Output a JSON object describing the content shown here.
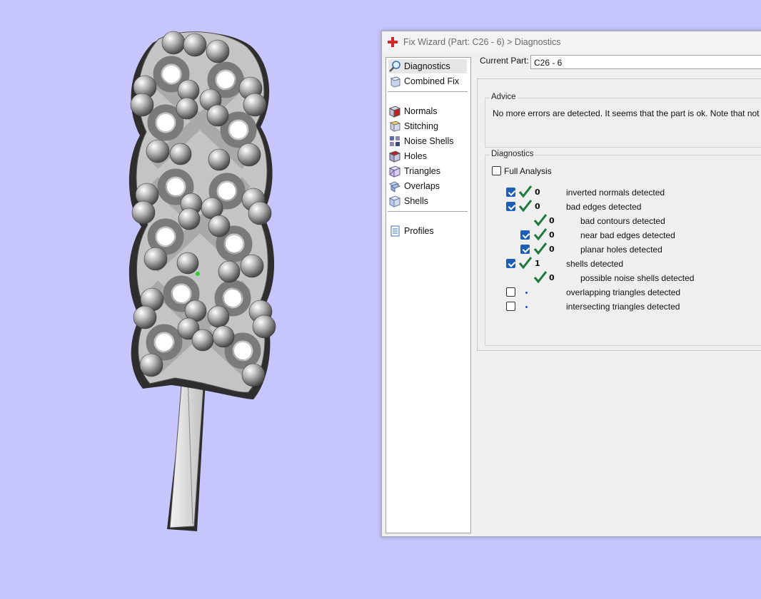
{
  "window": {
    "title": "Fix Wizard (Part: C26 - 6) > Diagnostics"
  },
  "nav": {
    "items": [
      {
        "label": "Diagnostics",
        "icon": "magnifier-icon"
      },
      {
        "label": "Combined Fix",
        "icon": "combined-fix-icon"
      },
      {
        "label": "Normals",
        "icon": "normals-icon"
      },
      {
        "label": "Stitching",
        "icon": "stitching-icon"
      },
      {
        "label": "Noise Shells",
        "icon": "noise-shells-icon"
      },
      {
        "label": "Holes",
        "icon": "holes-icon"
      },
      {
        "label": "Triangles",
        "icon": "triangles-icon"
      },
      {
        "label": "Overlaps",
        "icon": "overlaps-icon"
      },
      {
        "label": "Shells",
        "icon": "shells-icon"
      },
      {
        "label": "Profiles",
        "icon": "profiles-icon"
      }
    ]
  },
  "current_part": {
    "label": "Current Part:",
    "value": "C26 - 6"
  },
  "advice": {
    "legend": "Advice",
    "text": "No more errors are detected. It seems that the part is ok. Note that not all par"
  },
  "diagnostics": {
    "legend": "Diagnostics",
    "full_analysis": {
      "label": "Full Analysis",
      "checked": false
    },
    "rows": [
      {
        "count": "0",
        "label": "inverted normals detected",
        "checked": true,
        "status": "ok"
      },
      {
        "count": "0",
        "label": "bad edges detected",
        "checked": true,
        "status": "ok"
      },
      {
        "count": "0",
        "label": "bad contours detected",
        "checked": null,
        "status": "ok"
      },
      {
        "count": "0",
        "label": "near bad edges detected",
        "checked": true,
        "status": "ok"
      },
      {
        "count": "0",
        "label": "planar holes detected",
        "checked": true,
        "status": "ok"
      },
      {
        "count": "1",
        "label": "shells detected",
        "checked": true,
        "status": "ok"
      },
      {
        "count": "0",
        "label": "possible noise shells detected",
        "checked": null,
        "status": "ok"
      },
      {
        "count": "",
        "label": "overlapping triangles detected",
        "checked": false,
        "status": "not-run"
      },
      {
        "count": "",
        "label": "intersecting triangles detected",
        "checked": false,
        "status": "not-run"
      }
    ]
  },
  "colors": {
    "background": "#c6c6fc",
    "checkbox_checked": "#1c5fb8",
    "checkmark_green": "#1f7a3a",
    "title_text": "#6a6a6a"
  }
}
